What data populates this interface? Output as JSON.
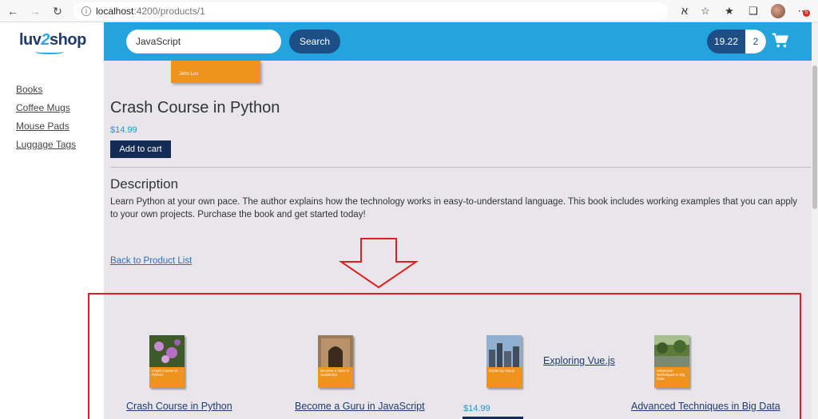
{
  "browser": {
    "url_host": "localhost",
    "url_path": ":4200/products/1",
    "notification_count": "5"
  },
  "brand": {
    "logo_left": "luv",
    "logo_mid": "2",
    "logo_right": "shop"
  },
  "sidebar": {
    "items": [
      {
        "label": "Books"
      },
      {
        "label": "Coffee Mugs"
      },
      {
        "label": "Mouse Pads"
      },
      {
        "label": "Luggage Tags"
      }
    ]
  },
  "header": {
    "search_value": "JavaScript",
    "search_button": "Search",
    "cart_total": "19.22",
    "cart_quantity": "2"
  },
  "product": {
    "cover_author": "John Luv",
    "title": "Crash Course in Python",
    "price": "$14.99",
    "add_to_cart": "Add to cart",
    "description_heading": "Description",
    "description": "Learn Python at your own pace. The author explains how the technology works in easy-to-understand language. This book includes working examples that you can apply to your own projects. Purchase the book and get started today!",
    "back_link": "Back to Product List"
  },
  "colors": {
    "header_blue": "#24a4df",
    "button_navy": "#1d4f86",
    "annotation_red": "#e02020",
    "book_orange": "#f0921e"
  },
  "cards": [
    {
      "title": "Crash Course in Python",
      "cover_text": "Crash Course in Python"
    },
    {
      "title": "Become a Guru in JavaScript",
      "cover_text": "Become a Guru in JavaScript"
    },
    {
      "title": "Exploring Vue.js",
      "cover_text": "Exploring Vue.js",
      "price": "$14.99"
    },
    {
      "title": "Advanced Techniques in Big Data",
      "cover_text": "Advanced Techniques in Big Data"
    }
  ]
}
